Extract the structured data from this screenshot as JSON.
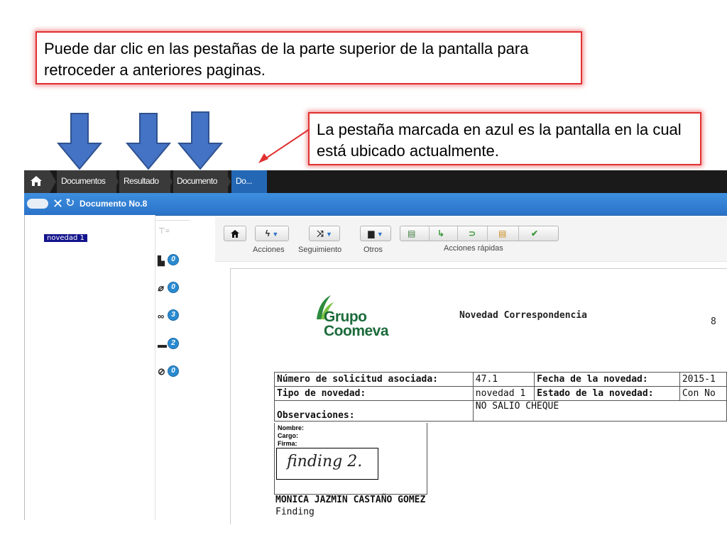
{
  "callouts": {
    "tabs_hint": "Puede dar clic en las pestañas de la parte superior de la pantalla para retroceder a anteriores paginas.",
    "current_hint": "La pestaña marcada en azul es la pantalla en la cual está ubicado actualmente."
  },
  "breadcrumb": {
    "items": [
      "Documentos",
      "Resultado",
      "Documento",
      "Do..."
    ],
    "active_index": 3
  },
  "tab": {
    "title": "Documento No.8"
  },
  "tree": {
    "node": "novedad 1"
  },
  "side_counts": {
    "documents": "0",
    "attachments": "0",
    "links": "3",
    "comments": "2",
    "history": "0"
  },
  "toolbar": {
    "acciones_label": "Acciones",
    "seguimiento_label": "Seguimiento",
    "otros_label": "Otros",
    "acciones_rapidas_label": "Acciones rápidas"
  },
  "document": {
    "logo_line1": "Grupo",
    "logo_line2": "Coomeva",
    "heading": "Novedad Correspondencia",
    "number": "8",
    "rows": {
      "solicitud_label": "Número de solicitud asociada:",
      "solicitud_value": "47.1",
      "fecha_label": "Fecha de la novedad:",
      "fecha_value": "2015-1",
      "tipo_label": "Tipo de novedad:",
      "tipo_value": "novedad 1",
      "estado_label": "Estado de la novedad:",
      "estado_value": "Con No",
      "obs_label": "Observaciones:",
      "obs_value": "NO SALIO CHEQUE"
    },
    "signature": {
      "nombre_label": "Nombre:",
      "cargo_label": "Cargo:",
      "firma_label": "Firma:",
      "handwriting": "finding 2.",
      "name": "MONICA JAZMIN CASTAÑO GOMEZ",
      "role": "Finding"
    }
  },
  "colors": {
    "active_tab": "#2468b5",
    "callout_border": "#e03030",
    "arrow": "#4472c4",
    "logo_green": "#1b6b3a"
  }
}
